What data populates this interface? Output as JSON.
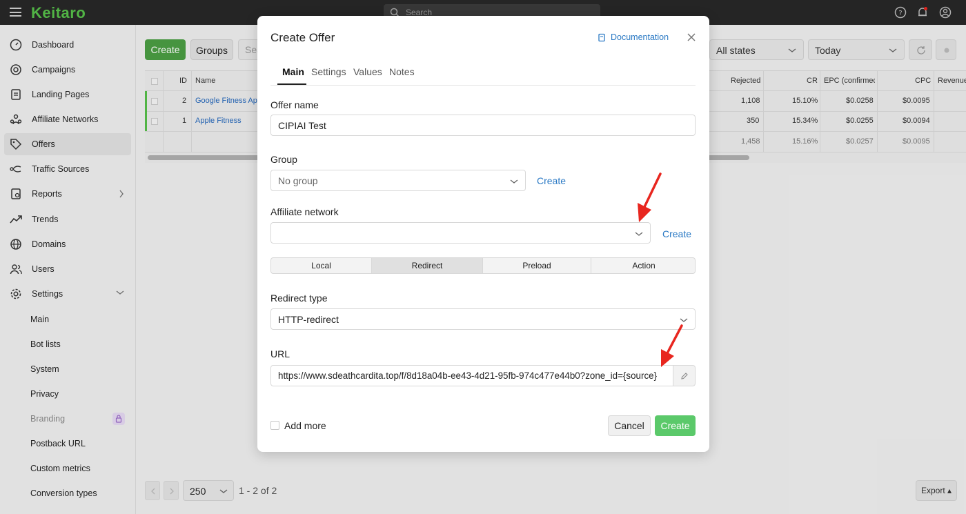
{
  "app": {
    "logo": "Keitaro",
    "search_placeholder": "Search"
  },
  "sidebar": {
    "items": [
      {
        "label": "Dashboard",
        "icon": "dashboard-icon"
      },
      {
        "label": "Campaigns",
        "icon": "target-icon"
      },
      {
        "label": "Landing Pages",
        "icon": "page-icon"
      },
      {
        "label": "Affiliate Networks",
        "icon": "network-icon"
      },
      {
        "label": "Offers",
        "icon": "tag-icon",
        "active": true
      },
      {
        "label": "Traffic Sources",
        "icon": "traffic-icon"
      },
      {
        "label": "Reports",
        "icon": "reports-icon"
      },
      {
        "label": "Trends",
        "icon": "trends-icon"
      },
      {
        "label": "Domains",
        "icon": "globe-icon"
      },
      {
        "label": "Users",
        "icon": "users-icon"
      },
      {
        "label": "Settings",
        "icon": "gear-icon"
      }
    ],
    "settings_sub": [
      "Main",
      "Bot lists",
      "System",
      "Privacy",
      "Branding",
      "Postback URL",
      "Custom metrics",
      "Conversion types"
    ]
  },
  "toolbar": {
    "create": "Create",
    "groups": "Groups",
    "search_placeholder": "Sea",
    "state_filter": "All states",
    "date_filter": "Today"
  },
  "table": {
    "headers": {
      "id": "ID",
      "name": "Name",
      "rejected": "Rejected",
      "cr": "CR",
      "epc": "EPC (confirmed)",
      "cpc": "CPC",
      "revenue": "Revenue"
    },
    "rows": [
      {
        "id": "2",
        "name": "Google Fitness App",
        "rejected": "1,108",
        "cr": "15.10%",
        "epc": "$0.0258",
        "cpc": "$0.0095"
      },
      {
        "id": "1",
        "name": "Apple Fitness",
        "rejected": "350",
        "cr": "15.34%",
        "epc": "$0.0255",
        "cpc": "$0.0094"
      }
    ],
    "totals": {
      "rejected": "1,458",
      "cr": "15.16%",
      "epc": "$0.0257",
      "cpc": "$0.0095"
    }
  },
  "pagination": {
    "page_size": "250",
    "range": "1 - 2 of 2",
    "export": "Export ▴"
  },
  "modal": {
    "title": "Create Offer",
    "documentation": "Documentation",
    "tabs": [
      "Main",
      "Settings",
      "Values",
      "Notes"
    ],
    "offer_name_label": "Offer name",
    "offer_name_value": "CIPIAI Test",
    "group_label": "Group",
    "group_value": "No group",
    "group_create": "Create",
    "affiliate_label": "Affiliate network",
    "affiliate_value": "",
    "affiliate_create": "Create",
    "action_types": [
      "Local",
      "Redirect",
      "Preload",
      "Action"
    ],
    "selected_action_type": "Redirect",
    "redirect_type_label": "Redirect type",
    "redirect_type_value": "HTTP-redirect",
    "url_label": "URL",
    "url_value": "https://www.sdeathcardita.top/f/8d18a04b-ee43-4d21-95fb-974c477e44b0?zone_id={source}",
    "add_more_label": "Add more",
    "cancel": "Cancel",
    "create": "Create"
  },
  "colors": {
    "brand_green": "#57c04a",
    "create_button": "#5bc96a",
    "link_blue": "#2a79c4",
    "annotation_red": "#e8261f"
  }
}
